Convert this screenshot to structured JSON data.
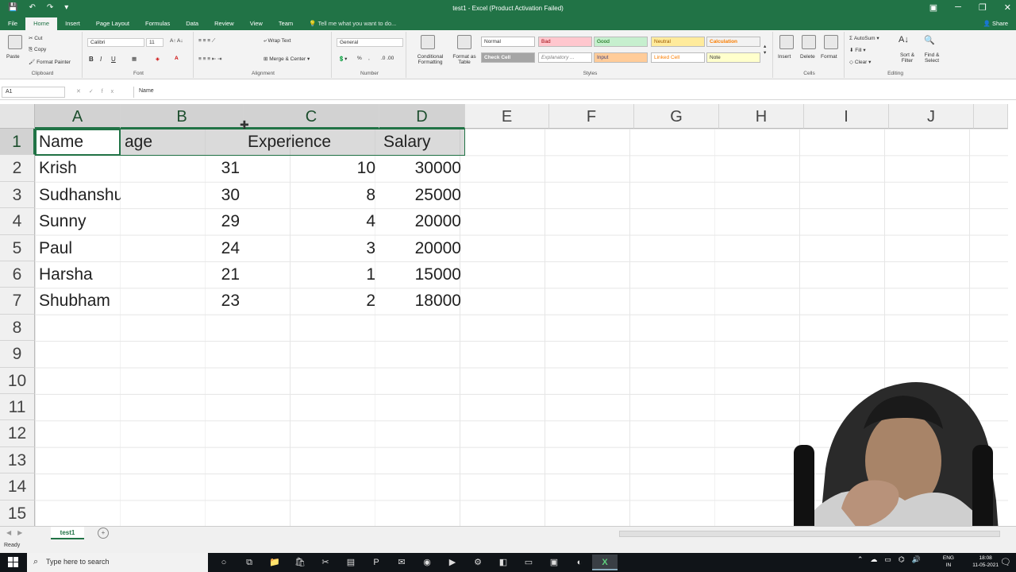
{
  "window": {
    "title": "test1 - Excel (Product Activation Failed)",
    "share_label": "Share"
  },
  "tabs": [
    "File",
    "Home",
    "Insert",
    "Page Layout",
    "Formulas",
    "Data",
    "Review",
    "View",
    "Team"
  ],
  "tell_me": "Tell me what you want to do...",
  "ribbon": {
    "clipboard": {
      "label": "Clipboard",
      "paste": "Paste",
      "cut": "Cut",
      "copy": "Copy",
      "format_painter": "Format Painter"
    },
    "font": {
      "label": "Font",
      "name": "Calibri",
      "size": "11",
      "bold": "B",
      "italic": "I",
      "underline": "U"
    },
    "alignment": {
      "label": "Alignment",
      "wrap_text": "Wrap Text",
      "merge_center": "Merge & Center"
    },
    "number": {
      "label": "Number",
      "format": "General",
      "percent": "%",
      "comma": ","
    },
    "styles": {
      "label": "Styles",
      "conditional": "Conditional Formatting",
      "format_table": "Format as Table",
      "cells": [
        "Normal",
        "Bad",
        "Good",
        "Neutral",
        "Calculation",
        "Check Cell",
        "Explanatory ...",
        "Input",
        "Linked Cell",
        "Note"
      ]
    },
    "cells": {
      "label": "Cells",
      "insert": "Insert",
      "delete": "Delete",
      "format": "Format"
    },
    "editing": {
      "label": "Editing",
      "autosum": "AutoSum",
      "fill": "Fill",
      "clear": "Clear",
      "sort_filter": "Sort & Filter",
      "find_select": "Find & Select"
    }
  },
  "formula_bar": {
    "name_box": "A1",
    "fx": "fx",
    "content": "Name"
  },
  "columns": [
    "A",
    "B",
    "C",
    "D",
    "E",
    "F",
    "G",
    "H",
    "I",
    "J"
  ],
  "rows": [
    "1",
    "2",
    "3",
    "4",
    "5",
    "6",
    "7",
    "8",
    "9",
    "10",
    "11",
    "12",
    "13",
    "14",
    "15"
  ],
  "sheet": {
    "headers": [
      "Name",
      "age",
      "Experience",
      "Salary"
    ],
    "data": [
      [
        "Krish",
        "31",
        "10",
        "30000"
      ],
      [
        "Sudhanshu",
        "30",
        "8",
        "25000"
      ],
      [
        "Sunny",
        "29",
        "4",
        "20000"
      ],
      [
        "Paul",
        "24",
        "3",
        "20000"
      ],
      [
        "Harsha",
        "21",
        "1",
        "15000"
      ],
      [
        "Shubham",
        "23",
        "2",
        "18000"
      ]
    ]
  },
  "sheet_tabs": {
    "active": "test1",
    "add": "+"
  },
  "status": {
    "text": "Ready"
  },
  "taskbar": {
    "search_placeholder": "Type here to search",
    "language": "ENG",
    "region": "IN",
    "time": "18:08",
    "date": "11-05-2021"
  },
  "colors": {
    "excel_green": "#217346",
    "taskbar": "#101418"
  }
}
